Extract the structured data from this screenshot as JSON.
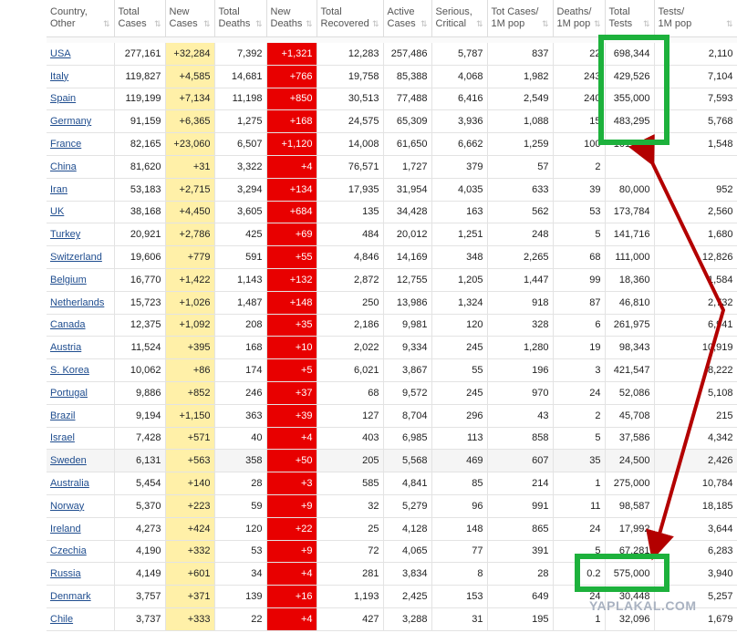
{
  "headers": [
    {
      "label": "Country,\nOther"
    },
    {
      "label": "Total\nCases"
    },
    {
      "label": "New\nCases"
    },
    {
      "label": "Total\nDeaths"
    },
    {
      "label": "New\nDeaths"
    },
    {
      "label": "Total\nRecovered"
    },
    {
      "label": "Active\nCases"
    },
    {
      "label": "Serious,\nCritical"
    },
    {
      "label": "Tot Cases/\n1M pop"
    },
    {
      "label": "Deaths/\n1M pop"
    },
    {
      "label": "Total\nTests"
    },
    {
      "label": "Tests/\n1M pop"
    }
  ],
  "sort_icon": "sort-arrows-icon",
  "rows": [
    [
      "USA",
      "277,161",
      "+32,284",
      "7,392",
      "+1,321",
      "12,283",
      "257,486",
      "5,787",
      "837",
      "22",
      "698,344",
      "2,110"
    ],
    [
      "Italy",
      "119,827",
      "+4,585",
      "14,681",
      "+766",
      "19,758",
      "85,388",
      "4,068",
      "1,982",
      "243",
      "429,526",
      "7,104"
    ],
    [
      "Spain",
      "119,199",
      "+7,134",
      "11,198",
      "+850",
      "30,513",
      "77,488",
      "6,416",
      "2,549",
      "240",
      "355,000",
      "7,593"
    ],
    [
      "Germany",
      "91,159",
      "+6,365",
      "1,275",
      "+168",
      "24,575",
      "65,309",
      "3,936",
      "1,088",
      "15",
      "483,295",
      "5,768"
    ],
    [
      "France",
      "82,165",
      "+23,060",
      "6,507",
      "+1,120",
      "14,008",
      "61,650",
      "6,662",
      "1,259",
      "100",
      "101,046",
      "1,548"
    ],
    [
      "China",
      "81,620",
      "+31",
      "3,322",
      "+4",
      "76,571",
      "1,727",
      "379",
      "57",
      "2",
      "",
      ""
    ],
    [
      "Iran",
      "53,183",
      "+2,715",
      "3,294",
      "+134",
      "17,935",
      "31,954",
      "4,035",
      "633",
      "39",
      "80,000",
      "952"
    ],
    [
      "UK",
      "38,168",
      "+4,450",
      "3,605",
      "+684",
      "135",
      "34,428",
      "163",
      "562",
      "53",
      "173,784",
      "2,560"
    ],
    [
      "Turkey",
      "20,921",
      "+2,786",
      "425",
      "+69",
      "484",
      "20,012",
      "1,251",
      "248",
      "5",
      "141,716",
      "1,680"
    ],
    [
      "Switzerland",
      "19,606",
      "+779",
      "591",
      "+55",
      "4,846",
      "14,169",
      "348",
      "2,265",
      "68",
      "111,000",
      "12,826"
    ],
    [
      "Belgium",
      "16,770",
      "+1,422",
      "1,143",
      "+132",
      "2,872",
      "12,755",
      "1,205",
      "1,447",
      "99",
      "18,360",
      "1,584"
    ],
    [
      "Netherlands",
      "15,723",
      "+1,026",
      "1,487",
      "+148",
      "250",
      "13,986",
      "1,324",
      "918",
      "87",
      "46,810",
      "2,732"
    ],
    [
      "Canada",
      "12,375",
      "+1,092",
      "208",
      "+35",
      "2,186",
      "9,981",
      "120",
      "328",
      "6",
      "261,975",
      "6,941"
    ],
    [
      "Austria",
      "11,524",
      "+395",
      "168",
      "+10",
      "2,022",
      "9,334",
      "245",
      "1,280",
      "19",
      "98,343",
      "10,919"
    ],
    [
      "S. Korea",
      "10,062",
      "+86",
      "174",
      "+5",
      "6,021",
      "3,867",
      "55",
      "196",
      "3",
      "421,547",
      "8,222"
    ],
    [
      "Portugal",
      "9,886",
      "+852",
      "246",
      "+37",
      "68",
      "9,572",
      "245",
      "970",
      "24",
      "52,086",
      "5,108"
    ],
    [
      "Brazil",
      "9,194",
      "+1,150",
      "363",
      "+39",
      "127",
      "8,704",
      "296",
      "43",
      "2",
      "45,708",
      "215"
    ],
    [
      "Israel",
      "7,428",
      "+571",
      "40",
      "+4",
      "403",
      "6,985",
      "113",
      "858",
      "5",
      "37,586",
      "4,342"
    ],
    [
      "Sweden",
      "6,131",
      "+563",
      "358",
      "+50",
      "205",
      "5,568",
      "469",
      "607",
      "35",
      "24,500",
      "2,426"
    ],
    [
      "Australia",
      "5,454",
      "+140",
      "28",
      "+3",
      "585",
      "4,841",
      "85",
      "214",
      "1",
      "275,000",
      "10,784"
    ],
    [
      "Norway",
      "5,370",
      "+223",
      "59",
      "+9",
      "32",
      "5,279",
      "96",
      "991",
      "11",
      "98,587",
      "18,185"
    ],
    [
      "Ireland",
      "4,273",
      "+424",
      "120",
      "+22",
      "25",
      "4,128",
      "148",
      "865",
      "24",
      "17,992",
      "3,644"
    ],
    [
      "Czechia",
      "4,190",
      "+332",
      "53",
      "+9",
      "72",
      "4,065",
      "77",
      "391",
      "5",
      "67,281",
      "6,283"
    ],
    [
      "Russia",
      "4,149",
      "+601",
      "34",
      "+4",
      "281",
      "3,834",
      "8",
      "28",
      "0.2",
      "575,000",
      "3,940"
    ],
    [
      "Denmark",
      "3,757",
      "+371",
      "139",
      "+16",
      "1,193",
      "2,425",
      "153",
      "649",
      "24",
      "30,448",
      "5,257"
    ],
    [
      "Chile",
      "3,737",
      "+333",
      "22",
      "+4",
      "427",
      "3,288",
      "31",
      "195",
      "1",
      "32,096",
      "1,679"
    ]
  ],
  "highlighted_row": 18,
  "annotation": {
    "box_color": "#1db13c",
    "arrow_color": "#b30000"
  },
  "watermark": "YAPLAKAL.COM"
}
